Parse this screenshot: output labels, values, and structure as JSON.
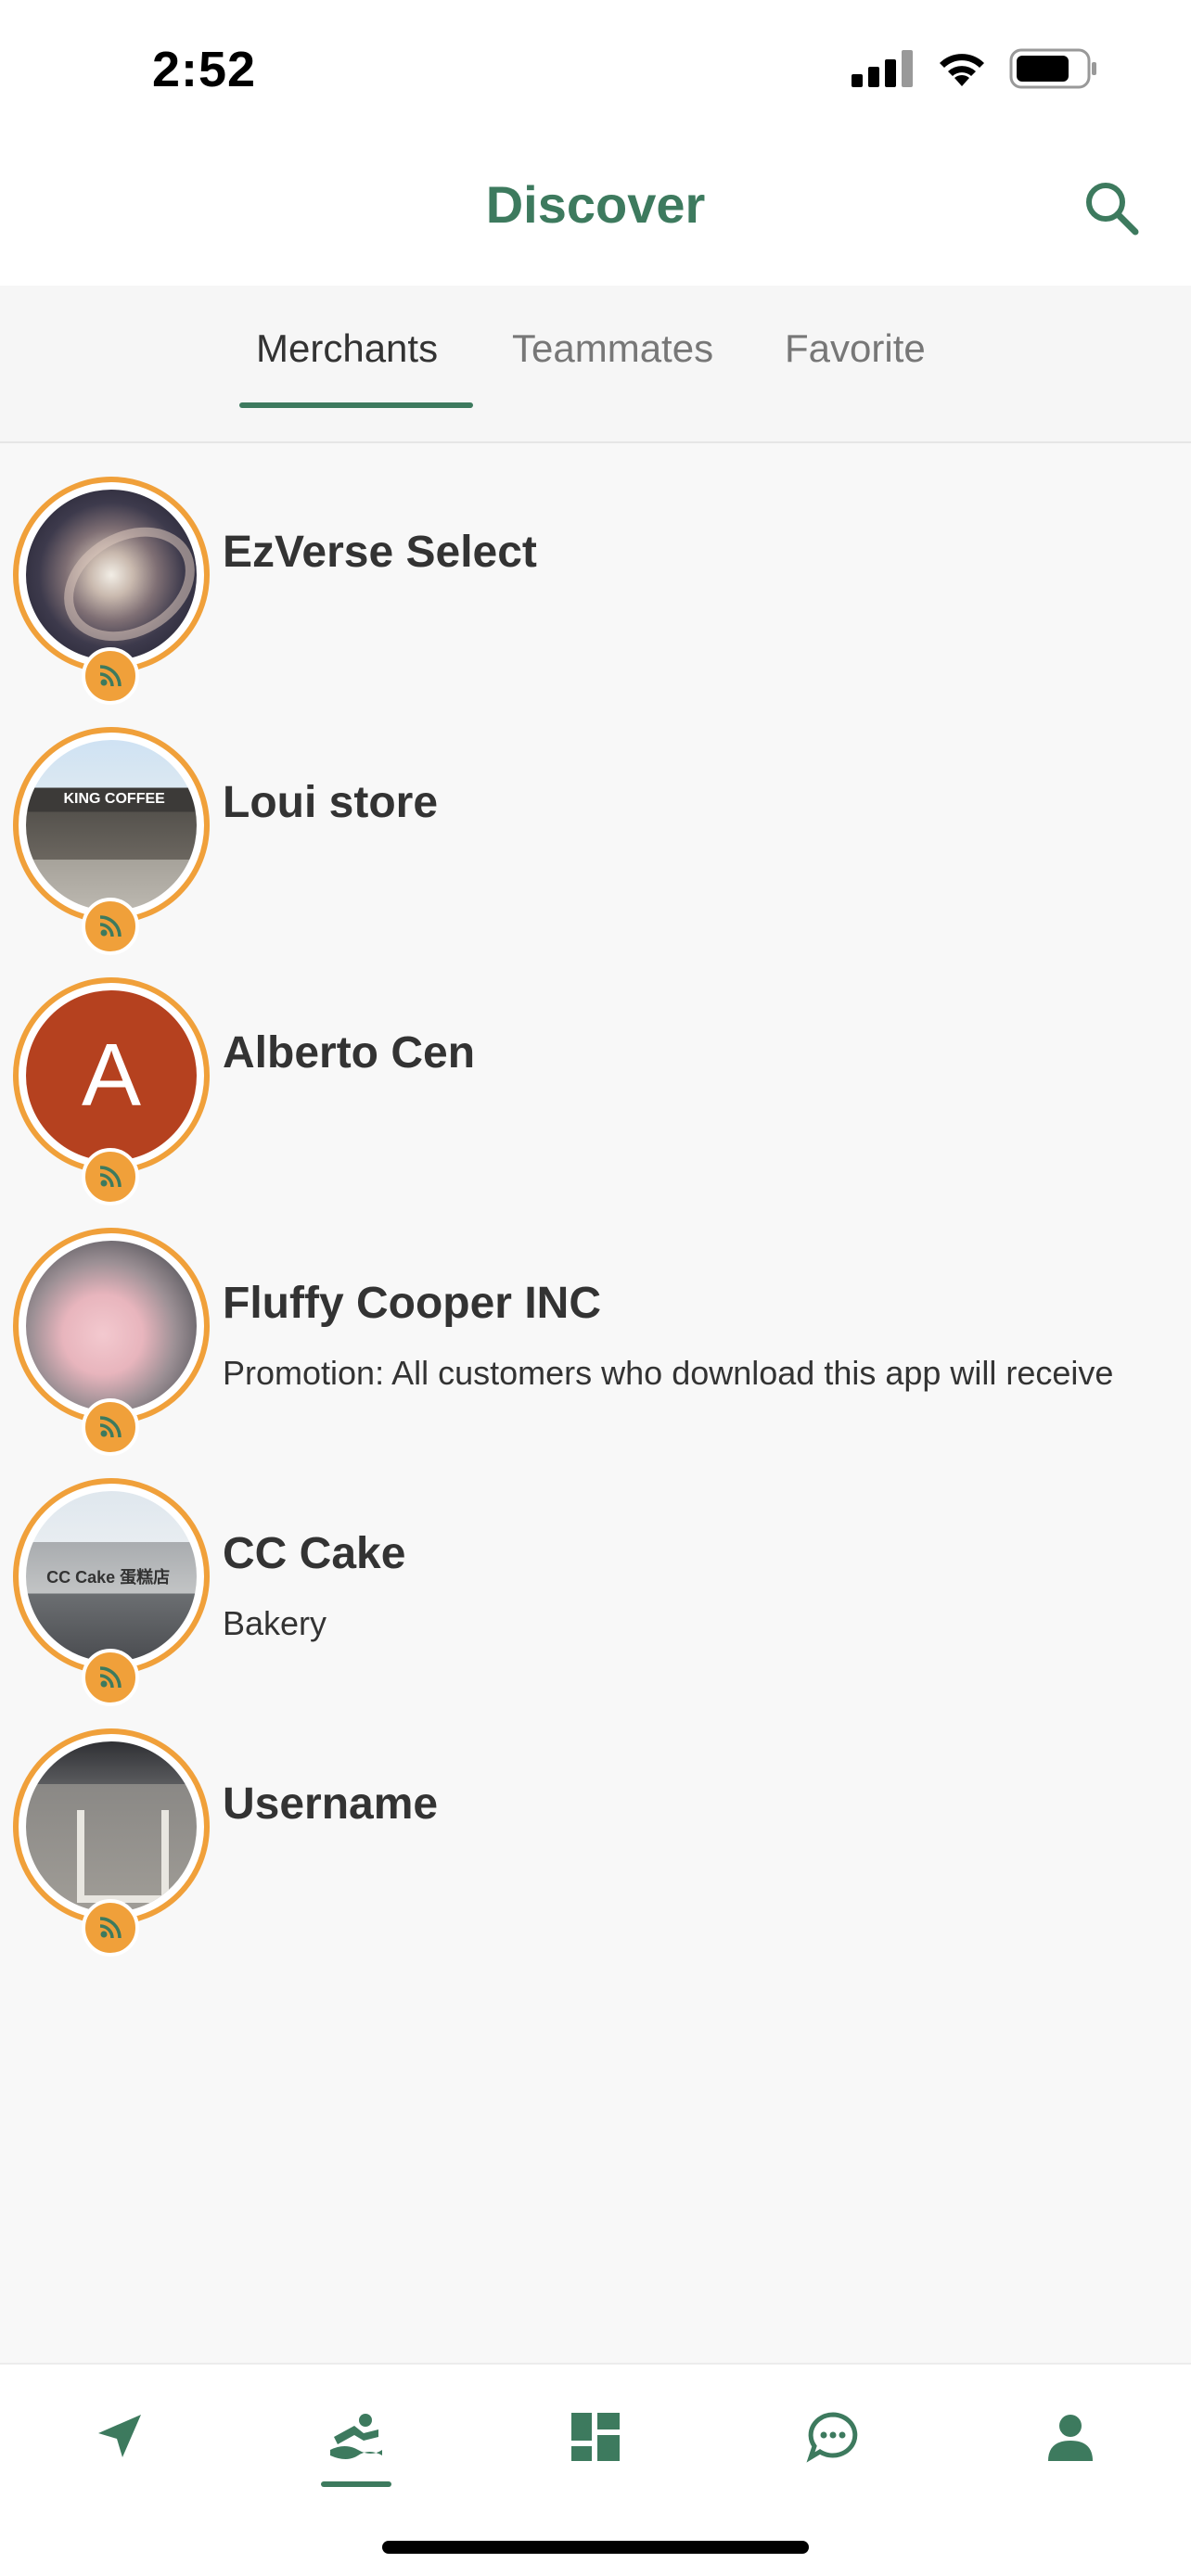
{
  "status_bar": {
    "time": "2:52"
  },
  "header": {
    "title": "Discover"
  },
  "tabs": [
    {
      "label": "Merchants",
      "active": true
    },
    {
      "label": "Teammates",
      "active": false
    },
    {
      "label": "Favorite",
      "active": false
    }
  ],
  "merchants": [
    {
      "name": "EzVerse Select",
      "subtitle": "",
      "avatar": "galaxy-photo"
    },
    {
      "name": "Loui store",
      "subtitle": "",
      "avatar": "coffee-shop-photo",
      "avatar_text": "KING COFFEE"
    },
    {
      "name": "Alberto Cen",
      "subtitle": "",
      "avatar": "letter",
      "avatar_letter": "A"
    },
    {
      "name": "Fluffy Cooper INC",
      "subtitle": "Promotion: All customers who download this app will receive",
      "avatar": "cotton-candy-photo"
    },
    {
      "name": "CC Cake",
      "subtitle": "Bakery",
      "avatar": "bakery-storefront-photo",
      "avatar_text": "CC Cake 蛋糕店"
    },
    {
      "name": "Username",
      "subtitle": "",
      "avatar": "parking-lot-photo"
    }
  ],
  "bottom_nav": [
    {
      "icon": "navigation-arrow-icon",
      "active": false
    },
    {
      "icon": "discover-icon",
      "active": true
    },
    {
      "icon": "dashboard-icon",
      "active": false
    },
    {
      "icon": "chat-icon",
      "active": false
    },
    {
      "icon": "profile-icon",
      "active": false
    }
  ],
  "colors": {
    "accent": "#3d7a5e",
    "badge": "#f0a03a",
    "letter_avatar": "#b5411f"
  }
}
